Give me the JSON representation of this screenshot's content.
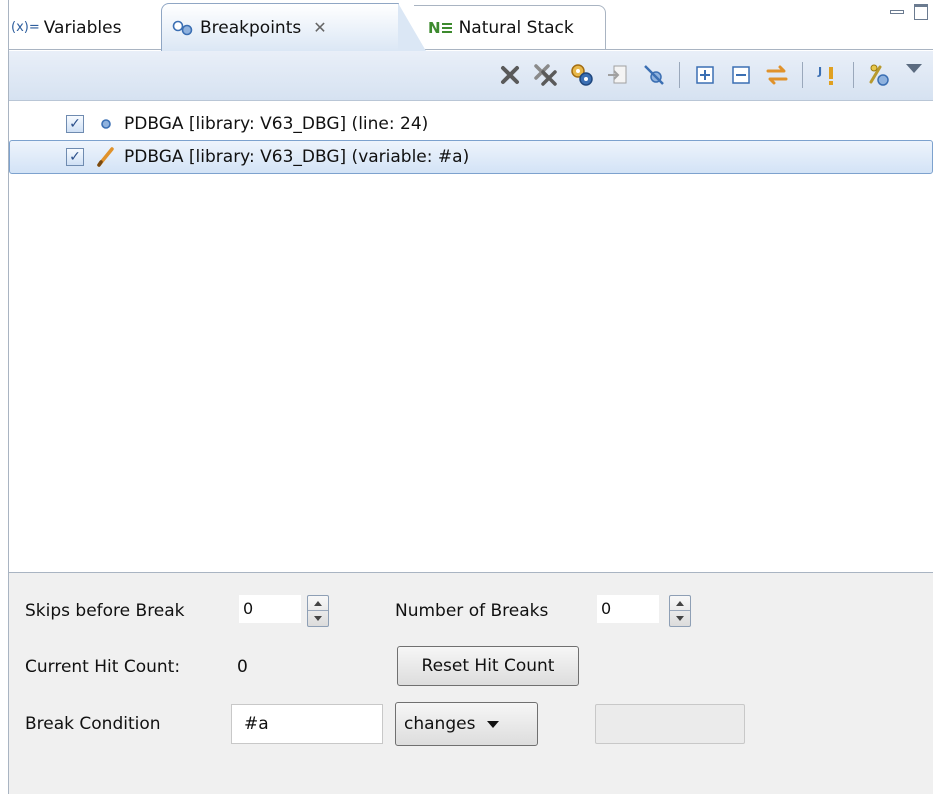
{
  "tabs": [
    {
      "label": "Variables",
      "icon": "variables-icon",
      "icon_text": "(x)="
    },
    {
      "label": "Breakpoints",
      "icon": "breakpoints-icon"
    },
    {
      "label": "Natural Stack",
      "icon": "natural-stack-icon",
      "icon_text": "N"
    }
  ],
  "breakpoints": [
    {
      "label": "PDBGA [library: V63_DBG] (line: 24)",
      "checked": true,
      "icon": "line-breakpoint-icon",
      "selected": false
    },
    {
      "label": "PDBGA [library: V63_DBG] (variable: #a)",
      "checked": true,
      "icon": "watchpoint-pencil-icon",
      "selected": true
    }
  ],
  "detail": {
    "skips_label": "Skips before Break",
    "skips_value": "0",
    "number_label": "Number of Breaks",
    "number_value": "0",
    "hit_count_label": "Current Hit Count:",
    "hit_count_value": "0",
    "reset_label": "Reset Hit Count",
    "condition_label": "Break Condition",
    "condition_value": "#a",
    "condition_mode": "changes"
  },
  "colors": {
    "accent_border": "#7da2ce",
    "toolbar_bg": "#d6e2f1",
    "icon_blue": "#3b6fb3",
    "icon_green": "#3d8a2e",
    "icon_orange": "#e0922b"
  }
}
